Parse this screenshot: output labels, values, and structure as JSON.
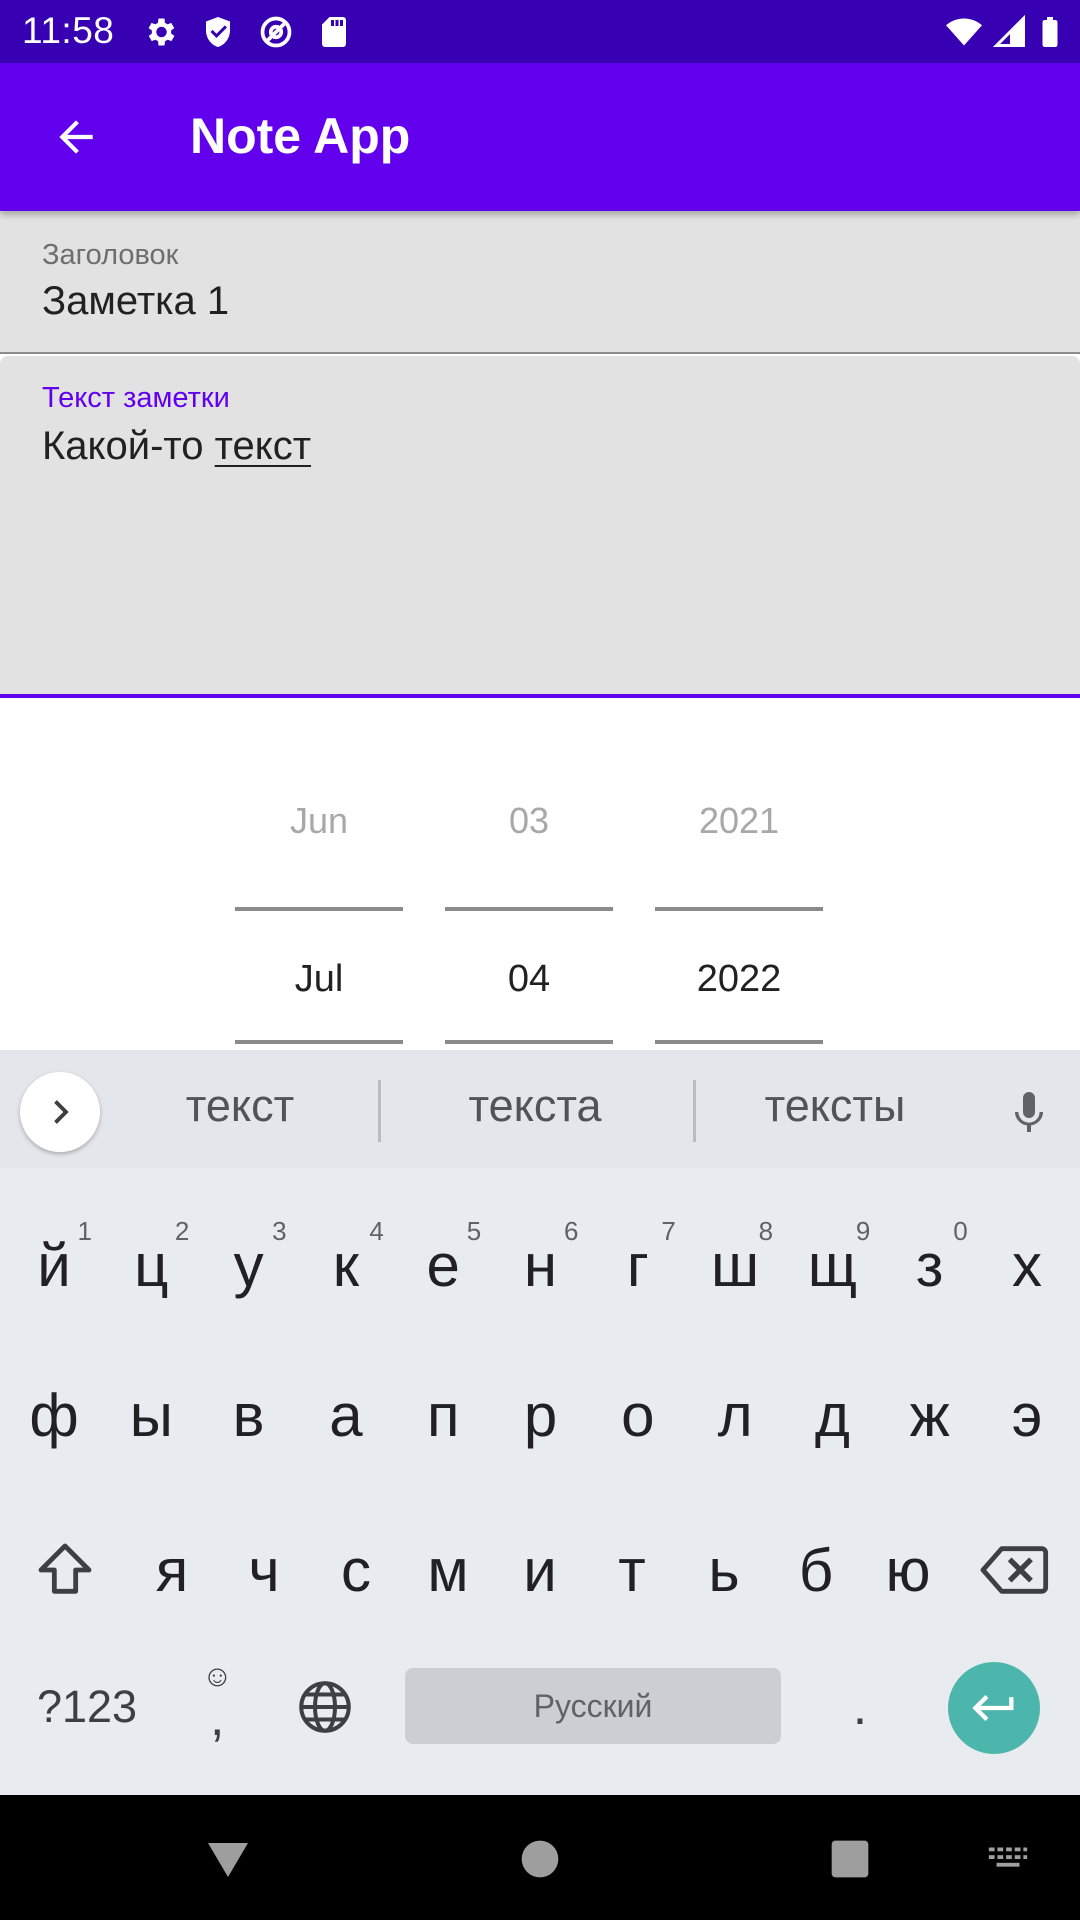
{
  "status_bar": {
    "time": "11:58",
    "left_icons": [
      "settings-icon",
      "shield-icon",
      "at-sign-icon",
      "sd-card-icon"
    ],
    "right_icons": [
      "wifi-icon",
      "cell-signal-icon",
      "battery-icon"
    ]
  },
  "app_bar": {
    "title": "Note App",
    "back_icon": "arrow-back-icon",
    "color": "#6200EE"
  },
  "title_field": {
    "label": "Заголовок",
    "value": "Заметка 1"
  },
  "body_field": {
    "label": "Текст заметки",
    "value_plain": "Какой-то ",
    "value_underlined": "текст",
    "accent": "#6200EE"
  },
  "date_picker": {
    "month": {
      "prev": "Jun",
      "current": "Jul"
    },
    "day": {
      "prev": "03",
      "current": "04"
    },
    "year": {
      "prev": "2021",
      "current": "2022"
    }
  },
  "keyboard": {
    "suggestions": [
      "текст",
      "текста",
      "тексты"
    ],
    "row1": [
      {
        "key": "й",
        "hint": "1"
      },
      {
        "key": "ц",
        "hint": "2"
      },
      {
        "key": "у",
        "hint": "3"
      },
      {
        "key": "к",
        "hint": "4"
      },
      {
        "key": "е",
        "hint": "5"
      },
      {
        "key": "н",
        "hint": "6"
      },
      {
        "key": "г",
        "hint": "7"
      },
      {
        "key": "ш",
        "hint": "8"
      },
      {
        "key": "щ",
        "hint": "9"
      },
      {
        "key": "з",
        "hint": "0"
      },
      {
        "key": "х",
        "hint": ""
      }
    ],
    "row2": [
      "ф",
      "ы",
      "в",
      "а",
      "п",
      "р",
      "о",
      "л",
      "д",
      "ж",
      "э"
    ],
    "row3": [
      "я",
      "ч",
      "с",
      "м",
      "и",
      "т",
      "ь",
      "б",
      "ю"
    ],
    "symbols_label": "?123",
    "comma_label": ",",
    "emoji_label": "☺",
    "space_label": "Русский",
    "period_label": ".",
    "enter_color": "#4db6ac"
  },
  "nav_bar": {
    "buttons": [
      "back-triangle-icon",
      "home-circle-icon",
      "recents-square-icon",
      "keyboard-switch-icon"
    ]
  }
}
